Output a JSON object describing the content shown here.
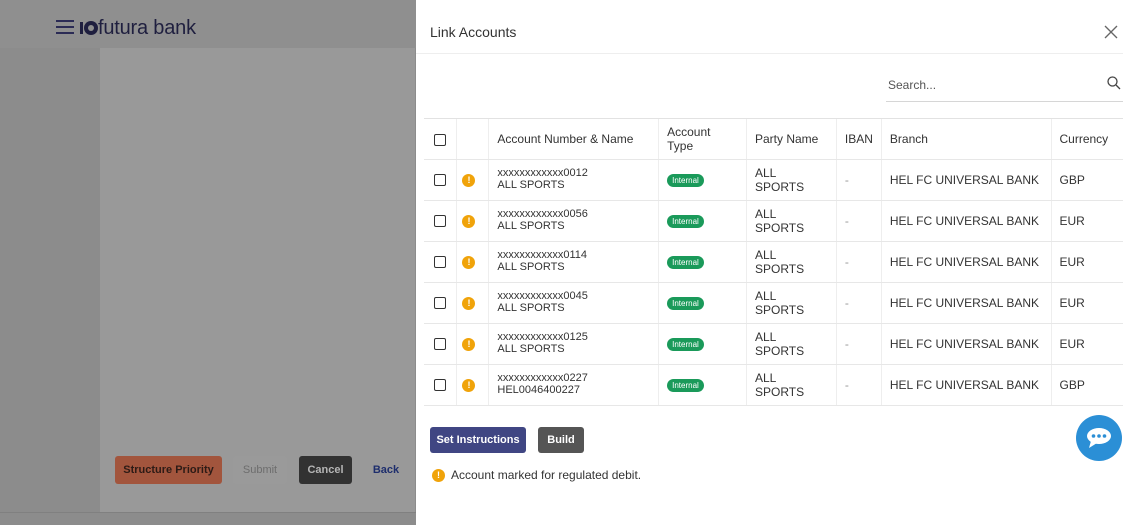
{
  "app": {
    "brand": "futura bank"
  },
  "background_buttons": {
    "structure_priority": "Structure Priority",
    "submit": "Submit",
    "cancel": "Cancel",
    "back": "Back"
  },
  "modal": {
    "title": "Link Accounts",
    "search_placeholder": "Search...",
    "columns": [
      "Account Number & Name",
      "Account Type",
      "Party Name",
      "IBAN",
      "Branch",
      "Currency"
    ],
    "rows": [
      {
        "number": "xxxxxxxxxxxx0012",
        "name": "ALL SPORTS",
        "type": "Internal",
        "party": "ALL SPORTS",
        "iban": "-",
        "branch": "HEL FC UNIVERSAL BANK",
        "currency": "GBP"
      },
      {
        "number": "xxxxxxxxxxxx0056",
        "name": "ALL SPORTS",
        "type": "Internal",
        "party": "ALL SPORTS",
        "iban": "-",
        "branch": "HEL FC UNIVERSAL BANK",
        "currency": "EUR"
      },
      {
        "number": "xxxxxxxxxxxx0114",
        "name": "ALL SPORTS",
        "type": "Internal",
        "party": "ALL SPORTS",
        "iban": "-",
        "branch": "HEL FC UNIVERSAL BANK",
        "currency": "EUR"
      },
      {
        "number": "xxxxxxxxxxxx0045",
        "name": "ALL SPORTS",
        "type": "Internal",
        "party": "ALL SPORTS",
        "iban": "-",
        "branch": "HEL FC UNIVERSAL BANK",
        "currency": "EUR"
      },
      {
        "number": "xxxxxxxxxxxx0125",
        "name": "ALL SPORTS",
        "type": "Internal",
        "party": "ALL SPORTS",
        "iban": "-",
        "branch": "HEL FC UNIVERSAL BANK",
        "currency": "EUR"
      },
      {
        "number": "xxxxxxxxxxxx0227",
        "name": "HEL0046400227",
        "type": "Internal",
        "party": "ALL SPORTS",
        "iban": "-",
        "branch": "HEL FC UNIVERSAL BANK",
        "currency": "GBP"
      }
    ],
    "buttons": {
      "set_instructions": "Set Instructions",
      "build": "Build"
    },
    "legend": "Account marked for regulated debit.",
    "info_glyph": "!"
  },
  "colors": {
    "accent_primary": "#404683",
    "badge_internal": "#1a9a5a",
    "info": "#f0a30a",
    "chat_fab": "#2b8fd6"
  }
}
